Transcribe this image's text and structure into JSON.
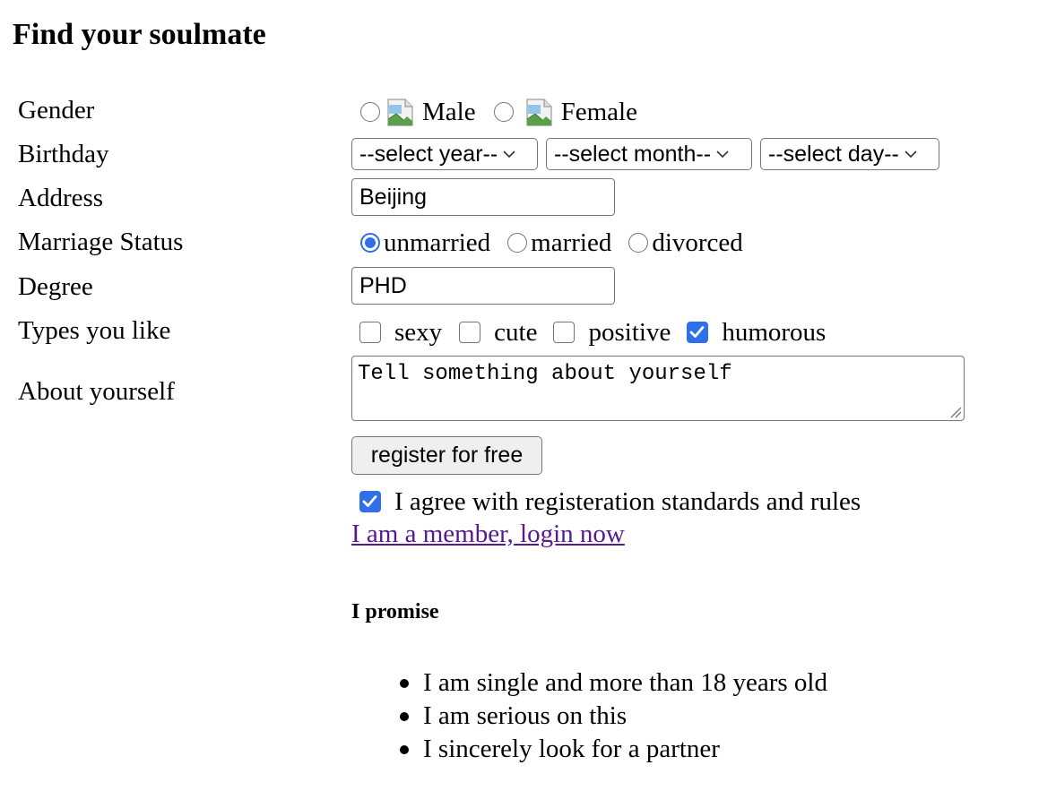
{
  "title": "Find your soulmate",
  "labels": {
    "gender": "Gender",
    "birthday": "Birthday",
    "address": "Address",
    "marriage": "Marriage Status",
    "degree": "Degree",
    "types": "Types you like",
    "about": "About yourself"
  },
  "gender": {
    "options": [
      {
        "label": "Male",
        "checked": false,
        "icon": "broken-image-icon"
      },
      {
        "label": "Female",
        "checked": false,
        "icon": "broken-image-icon"
      }
    ]
  },
  "birthday": {
    "year": "--select year--",
    "month": "--select month--",
    "day": "--select day--"
  },
  "address": {
    "value": "Beijing"
  },
  "marriage": {
    "options": [
      {
        "label": "unmarried",
        "checked": true
      },
      {
        "label": "married",
        "checked": false
      },
      {
        "label": "divorced",
        "checked": false
      }
    ]
  },
  "degree": {
    "value": "PHD"
  },
  "types": {
    "options": [
      {
        "label": "sexy",
        "checked": false
      },
      {
        "label": "cute",
        "checked": false
      },
      {
        "label": "positive",
        "checked": false
      },
      {
        "label": "humorous",
        "checked": true
      }
    ]
  },
  "about": {
    "placeholder": "Tell something about yourself"
  },
  "register_button": "register for free",
  "agree": {
    "label": "I agree with registeration standards and rules",
    "checked": true
  },
  "login_link": "I am a member, login now",
  "promise": {
    "heading": "I promise",
    "items": [
      "I am single and more than 18 years old",
      "I am serious on this",
      "I sincerely look for a partner"
    ]
  },
  "colors": {
    "accent": "#2f6fea",
    "visited_link": "#551a8b",
    "border": "#767676"
  }
}
